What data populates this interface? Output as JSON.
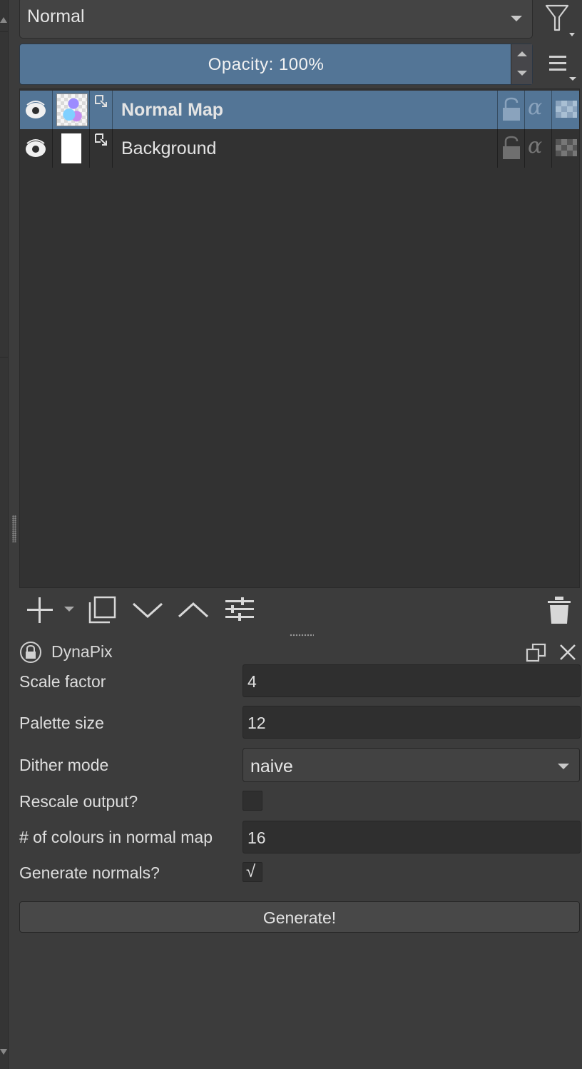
{
  "layers_docker": {
    "blend_mode": "Normal",
    "opacity_label": "Opacity:  100%",
    "opacity_percent": 100,
    "layers": [
      {
        "name": "Normal Map",
        "selected": true,
        "visible": true
      },
      {
        "name": "Background",
        "selected": false,
        "visible": true
      }
    ]
  },
  "plugin": {
    "title": "DynaPix",
    "fields": {
      "scale_factor_label": "Scale factor",
      "scale_factor_value": "4",
      "palette_size_label": "Palette size",
      "palette_size_value": "12",
      "dither_mode_label": "Dither mode",
      "dither_mode_value": "naive",
      "rescale_output_label": "Rescale output?",
      "rescale_output_checked": false,
      "colours_label": "# of colours in normal map",
      "colours_value": "16",
      "generate_normals_label": "Generate normals?",
      "generate_normals_checked": true,
      "check_mark": "√"
    },
    "generate_label": "Generate!"
  },
  "colors": {
    "panel_bg": "#3c3c3c",
    "list_bg": "#323232",
    "selection": "#537596"
  },
  "icons": [
    "filter-icon",
    "menu-icon",
    "eye-icon",
    "clip-icon",
    "lock-icon",
    "alpha-icon",
    "inherit-alpha-icon",
    "add-icon",
    "duplicate-icon",
    "move-down-icon",
    "move-up-icon",
    "properties-icon",
    "trash-icon",
    "lock-circle-icon",
    "float-icon",
    "close-icon"
  ]
}
